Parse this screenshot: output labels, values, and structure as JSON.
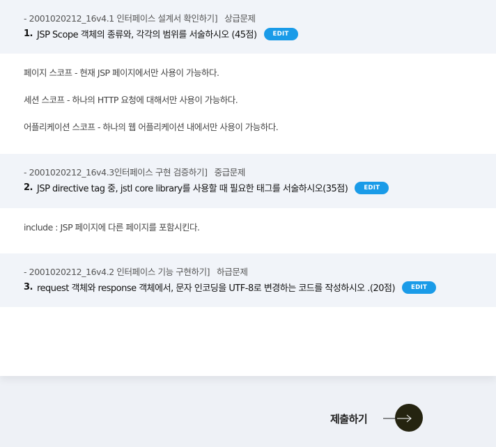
{
  "questions": [
    {
      "meta": "- 2001020212_16v4.1 인터페이스 설계서 확인하기]",
      "level": "상급문제",
      "number": "1.",
      "title": "JSP Scope 객체의 종류와, 각각의 범위를 서술하시오  (45점)",
      "edit_label": "EDIT",
      "answers": [
        "페이지 스코프 - 현재 JSP 페이지에서만 사용이 가능하다.",
        "세션 스코프 - 하나의 HTTP 요청에 대해서만 사용이 가능하다.",
        "어플리케이션 스코프 - 하나의 웹 어플리케이션 내에서만 사용이 가능하다."
      ]
    },
    {
      "meta": "- 2001020212_16v4.3인터페이스 구현 검증하기]",
      "level": "중급문제",
      "number": "2.",
      "title": "JSP directive tag 중, jstl core library를 사용할 때 필요한 태그를 서술하시오(35점)",
      "edit_label": "EDIT",
      "answers": [
        "include : JSP 페이지에 다른 페이지를 포함시킨다."
      ]
    },
    {
      "meta": "- 2001020212_16v4.2 인터페이스 기능 구현하기]",
      "level": "하급문제",
      "number": "3.",
      "title": "request 객체와 response 객체에서, 문자 인코딩을 UTF-8로 변경하는 코드를 작성하시오 .(20점)",
      "edit_label": "EDIT",
      "answers": []
    }
  ],
  "submit": {
    "label": "제출하기",
    "icon": "arrow-right-icon"
  },
  "colors": {
    "accent": "#1a9be8",
    "header_bg": "#f1f4f9",
    "submit_circle": "#252410"
  }
}
